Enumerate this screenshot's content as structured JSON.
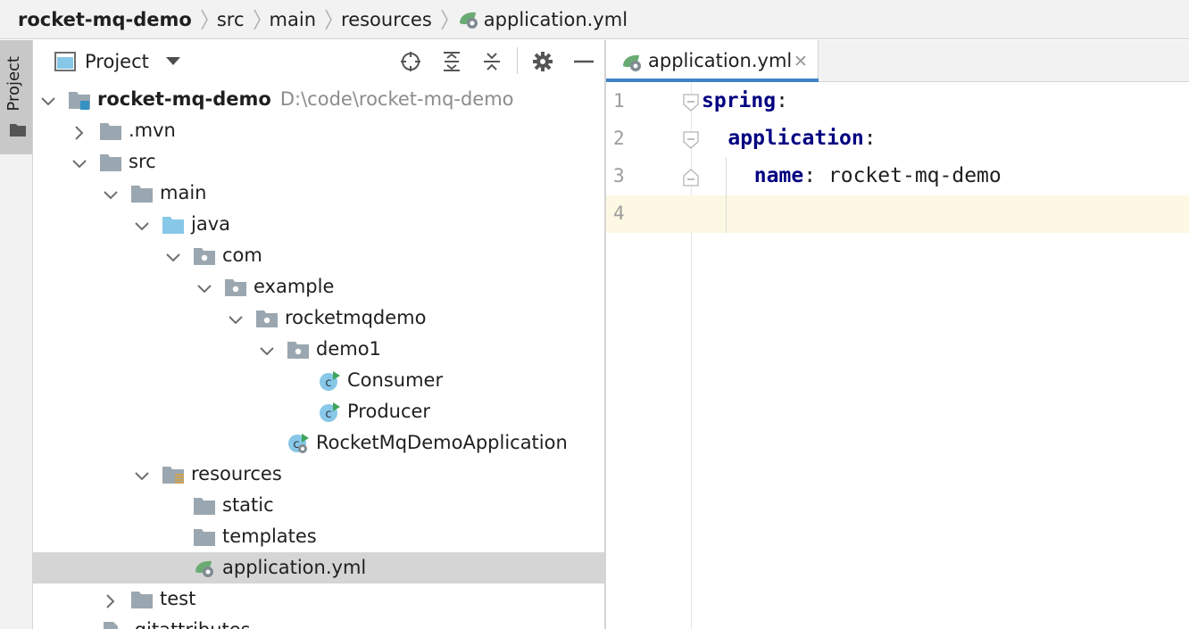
{
  "breadcrumb": {
    "items": [
      "rocket-mq-demo",
      "src",
      "main",
      "resources",
      "application.yml"
    ]
  },
  "tool_stripe": {
    "project_label": "Project"
  },
  "project_panel": {
    "title": "Project",
    "tree": [
      {
        "label": "rocket-mq-demo",
        "path": "D:\\code\\rocket-mq-demo",
        "icon": "module-folder-icon",
        "expanded": true
      },
      {
        "label": ".mvn",
        "icon": "folder-icon",
        "expanded": false
      },
      {
        "label": "src",
        "icon": "folder-icon",
        "expanded": true
      },
      {
        "label": "main",
        "icon": "folder-icon",
        "expanded": true
      },
      {
        "label": "java",
        "icon": "source-root-folder-icon",
        "expanded": true
      },
      {
        "label": "com",
        "icon": "package-icon",
        "expanded": true
      },
      {
        "label": "example",
        "icon": "package-icon",
        "expanded": true
      },
      {
        "label": "rocketmqdemo",
        "icon": "package-icon",
        "expanded": true
      },
      {
        "label": "demo1",
        "icon": "package-icon",
        "expanded": true
      },
      {
        "label": "Consumer",
        "icon": "java-class-runnable-icon"
      },
      {
        "label": "Producer",
        "icon": "java-class-runnable-icon"
      },
      {
        "label": "RocketMqDemoApplication",
        "icon": "spring-boot-class-icon"
      },
      {
        "label": "resources",
        "icon": "resources-root-folder-icon",
        "expanded": true
      },
      {
        "label": "static",
        "icon": "folder-icon"
      },
      {
        "label": "templates",
        "icon": "folder-icon"
      },
      {
        "label": "application.yml",
        "icon": "spring-yaml-file-icon",
        "selected": true
      },
      {
        "label": "test",
        "icon": "folder-icon",
        "expanded": false
      },
      {
        "label": ".gitattributes",
        "icon": "text-file-icon"
      }
    ]
  },
  "editor": {
    "tab_label": "application.yml",
    "current_line": 4,
    "lines": [
      {
        "num": "1",
        "key": "spring",
        "colon": ":",
        "value": ""
      },
      {
        "num": "2",
        "key": "application",
        "colon": ":",
        "value": ""
      },
      {
        "num": "3",
        "key": "name",
        "colon": ":",
        "value": " rocket-mq-demo"
      },
      {
        "num": "4",
        "key": "",
        "colon": "",
        "value": ""
      }
    ]
  },
  "colors": {
    "yaml_key": "#000080",
    "selection": "#d5d5d5",
    "current_line": "#fcf8e3",
    "tab_underline": "#4083c9",
    "folder": "#9aa7b0",
    "source_folder": "#87c7e8"
  }
}
